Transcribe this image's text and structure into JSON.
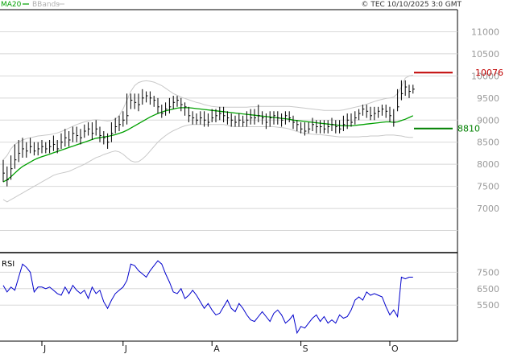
{
  "header": {
    "ma_label": "MA20",
    "bb_label": "BBands",
    "credit": "© TEC 10/10/2025 3:0 GMT"
  },
  "colors": {
    "ma": "#00a000",
    "bbands": "#c8c8c8",
    "price": "#000000",
    "rsi": "#0000cc",
    "resistance": "#c00000",
    "support": "#008000",
    "grid": "#d8d8d8",
    "axis": "#000000"
  },
  "chart_data": [
    {
      "type": "ohlc",
      "title": "",
      "ylim": [
        6000,
        11500
      ],
      "ytick_values": [
        7000,
        7500,
        8000,
        8500,
        9000,
        9500,
        10000,
        10500,
        11000
      ],
      "ytick_labels": [
        "7000",
        "7500",
        "8000",
        "8500",
        "9000",
        "9500",
        "10000",
        "10500",
        "11000"
      ],
      "x_months": [
        {
          "label": "J",
          "index": 10
        },
        {
          "label": "J",
          "index": 31
        },
        {
          "label": "A",
          "index": 54
        },
        {
          "label": "S",
          "index": 77
        },
        {
          "label": "O",
          "index": 100
        }
      ],
      "n_bars": 107,
      "close": [
        7800,
        7650,
        7900,
        8100,
        8250,
        8350,
        8300,
        8400,
        8300,
        8350,
        8400,
        8350,
        8400,
        8450,
        8350,
        8500,
        8600,
        8550,
        8700,
        8650,
        8600,
        8750,
        8800,
        8700,
        8800,
        8650,
        8600,
        8500,
        8700,
        8850,
        8900,
        9000,
        9100,
        9450,
        9400,
        9350,
        9500,
        9550,
        9500,
        9450,
        9300,
        9150,
        9250,
        9300,
        9400,
        9450,
        9350,
        9300,
        9100,
        9050,
        9000,
        9050,
        9000,
        8950,
        9050,
        9100,
        9150,
        9100,
        9050,
        9000,
        8950,
        9000,
        8950,
        9000,
        9050,
        9050,
        9100,
        9050,
        8950,
        9050,
        9100,
        9050,
        9000,
        9100,
        9050,
        8950,
        8900,
        8800,
        8750,
        8800,
        8900,
        8850,
        8850,
        8800,
        8850,
        8900,
        8850,
        8800,
        8900,
        9000,
        8950,
        9050,
        9150,
        9250,
        9200,
        9100,
        9150,
        9200,
        9250,
        9200,
        9100,
        8950,
        9300,
        9600,
        9750,
        9650,
        9700
      ],
      "high": [
        8100,
        7950,
        8200,
        8450,
        8550,
        8600,
        8500,
        8600,
        8500,
        8500,
        8550,
        8500,
        8550,
        8650,
        8550,
        8700,
        8800,
        8750,
        8850,
        8850,
        8800,
        8900,
        8950,
        8950,
        9000,
        8850,
        8750,
        8700,
        8950,
        9050,
        9100,
        9200,
        9600,
        9600,
        9600,
        9600,
        9700,
        9650,
        9650,
        9550,
        9500,
        9350,
        9400,
        9500,
        9550,
        9550,
        9500,
        9400,
        9300,
        9200,
        9150,
        9200,
        9200,
        9150,
        9250,
        9250,
        9300,
        9300,
        9200,
        9150,
        9100,
        9150,
        9100,
        9200,
        9250,
        9250,
        9350,
        9200,
        9150,
        9200,
        9200,
        9200,
        9150,
        9200,
        9200,
        9100,
        9000,
        8950,
        8950,
        8950,
        9050,
        9000,
        9000,
        9000,
        9000,
        9050,
        9000,
        9000,
        9100,
        9150,
        9150,
        9200,
        9250,
        9350,
        9350,
        9300,
        9300,
        9300,
        9350,
        9350,
        9300,
        9250,
        9700,
        9900,
        9900,
        9800,
        9800
      ],
      "low": [
        7600,
        7500,
        7650,
        7900,
        8050,
        8150,
        8150,
        8250,
        8200,
        8200,
        8250,
        8250,
        8250,
        8300,
        8250,
        8350,
        8400,
        8400,
        8500,
        8500,
        8450,
        8600,
        8650,
        8550,
        8650,
        8500,
        8450,
        8350,
        8500,
        8700,
        8750,
        8850,
        8900,
        9250,
        9250,
        9200,
        9350,
        9400,
        9350,
        9300,
        9150,
        9050,
        9100,
        9150,
        9250,
        9300,
        9200,
        9100,
        8950,
        8900,
        8900,
        8900,
        8850,
        8850,
        8950,
        8950,
        9000,
        8950,
        8900,
        8850,
        8850,
        8850,
        8850,
        8850,
        8900,
        8900,
        8950,
        8900,
        8800,
        8850,
        8900,
        8900,
        8850,
        8900,
        8950,
        8800,
        8750,
        8700,
        8650,
        8700,
        8750,
        8700,
        8700,
        8700,
        8700,
        8750,
        8700,
        8700,
        8750,
        8800,
        8850,
        8900,
        9000,
        9100,
        9050,
        9000,
        9000,
        9050,
        9100,
        9050,
        8950,
        8850,
        9200,
        9450,
        9550,
        9500,
        9600
      ],
      "ma20": [
        7600,
        7650,
        7720,
        7800,
        7880,
        7950,
        8000,
        8050,
        8100,
        8140,
        8170,
        8200,
        8230,
        8260,
        8290,
        8320,
        8350,
        8380,
        8410,
        8440,
        8470,
        8500,
        8530,
        8560,
        8590,
        8600,
        8620,
        8630,
        8650,
        8670,
        8700,
        8730,
        8770,
        8820,
        8870,
        8920,
        8970,
        9020,
        9070,
        9110,
        9150,
        9180,
        9210,
        9230,
        9250,
        9270,
        9280,
        9280,
        9280,
        9270,
        9260,
        9250,
        9240,
        9230,
        9220,
        9210,
        9200,
        9190,
        9180,
        9170,
        9160,
        9150,
        9140,
        9130,
        9120,
        9110,
        9100,
        9090,
        9080,
        9070,
        9060,
        9050,
        9040,
        9030,
        9020,
        9000,
        8990,
        8980,
        8970,
        8960,
        8950,
        8940,
        8930,
        8920,
        8910,
        8900,
        8890,
        8880,
        8870,
        8870,
        8870,
        8880,
        8890,
        8900,
        8910,
        8920,
        8930,
        8940,
        8950,
        8960,
        8960,
        8950,
        8960,
        8990,
        9020,
        9060,
        9100
      ],
      "bb_upper": [
        8100,
        8200,
        8350,
        8450,
        8500,
        8550,
        8580,
        8600,
        8620,
        8640,
        8650,
        8660,
        8670,
        8690,
        8710,
        8740,
        8780,
        8820,
        8860,
        8900,
        8930,
        8960,
        8980,
        9000,
        9010,
        9000,
        8990,
        8980,
        8990,
        9020,
        9100,
        9250,
        9450,
        9650,
        9780,
        9850,
        9880,
        9890,
        9880,
        9860,
        9820,
        9780,
        9720,
        9660,
        9600,
        9560,
        9520,
        9490,
        9460,
        9430,
        9400,
        9380,
        9350,
        9330,
        9310,
        9300,
        9290,
        9290,
        9290,
        9290,
        9290,
        9290,
        9290,
        9290,
        9300,
        9300,
        9310,
        9310,
        9310,
        9310,
        9310,
        9310,
        9310,
        9310,
        9310,
        9300,
        9290,
        9280,
        9270,
        9260,
        9250,
        9240,
        9230,
        9220,
        9220,
        9220,
        9220,
        9220,
        9230,
        9250,
        9270,
        9290,
        9310,
        9330,
        9360,
        9390,
        9420,
        9450,
        9470,
        9490,
        9500,
        9520,
        9600,
        9750,
        9950,
        10000,
        10020
      ],
      "bb_lower": [
        7200,
        7150,
        7200,
        7250,
        7300,
        7350,
        7400,
        7450,
        7500,
        7550,
        7600,
        7650,
        7700,
        7750,
        7780,
        7800,
        7820,
        7840,
        7880,
        7920,
        7960,
        8000,
        8050,
        8100,
        8150,
        8180,
        8220,
        8250,
        8280,
        8300,
        8280,
        8230,
        8150,
        8080,
        8050,
        8060,
        8120,
        8200,
        8300,
        8400,
        8500,
        8580,
        8650,
        8710,
        8760,
        8800,
        8840,
        8870,
        8890,
        8900,
        8900,
        8900,
        8900,
        8900,
        8900,
        8900,
        8900,
        8900,
        8880,
        8860,
        8850,
        8850,
        8850,
        8850,
        8850,
        8850,
        8850,
        8850,
        8850,
        8850,
        8850,
        8840,
        8830,
        8820,
        8800,
        8770,
        8740,
        8720,
        8700,
        8690,
        8680,
        8670,
        8670,
        8660,
        8650,
        8640,
        8630,
        8620,
        8620,
        8620,
        8620,
        8620,
        8620,
        8630,
        8630,
        8640,
        8640,
        8640,
        8650,
        8660,
        8660,
        8660,
        8650,
        8640,
        8620,
        8610,
        8610
      ],
      "resistance": {
        "value": 10076,
        "label": "10076"
      },
      "support": {
        "value": 8810,
        "label": "8810"
      }
    },
    {
      "type": "line",
      "panel_label": "RSI",
      "ylim": [
        35,
        85
      ],
      "ytick_values": [
        55,
        65,
        75
      ],
      "ytick_labels": [
        "5500",
        "6500",
        "7500"
      ],
      "values": [
        67,
        63,
        66,
        64,
        72,
        80,
        78,
        75,
        63,
        66,
        66,
        65,
        66,
        64,
        62,
        61,
        66,
        62,
        67,
        64,
        62,
        64,
        59,
        66,
        62,
        64,
        57,
        53,
        58,
        62,
        64,
        66,
        70,
        80,
        79,
        76,
        74,
        72,
        76,
        79,
        82,
        80,
        74,
        69,
        63,
        62,
        65,
        59,
        61,
        64,
        61,
        57,
        53,
        56,
        52,
        49,
        50,
        54,
        58,
        53,
        51,
        56,
        53,
        49,
        46,
        45,
        48,
        51,
        48,
        45,
        50,
        52,
        49,
        44,
        46,
        49,
        38,
        42,
        41,
        44,
        47,
        49,
        45,
        48,
        44,
        46,
        44,
        49,
        47,
        48,
        52,
        58,
        60,
        58,
        63,
        61,
        62,
        61,
        60,
        54,
        49,
        52,
        48,
        72,
        71,
        72,
        72
      ]
    }
  ]
}
